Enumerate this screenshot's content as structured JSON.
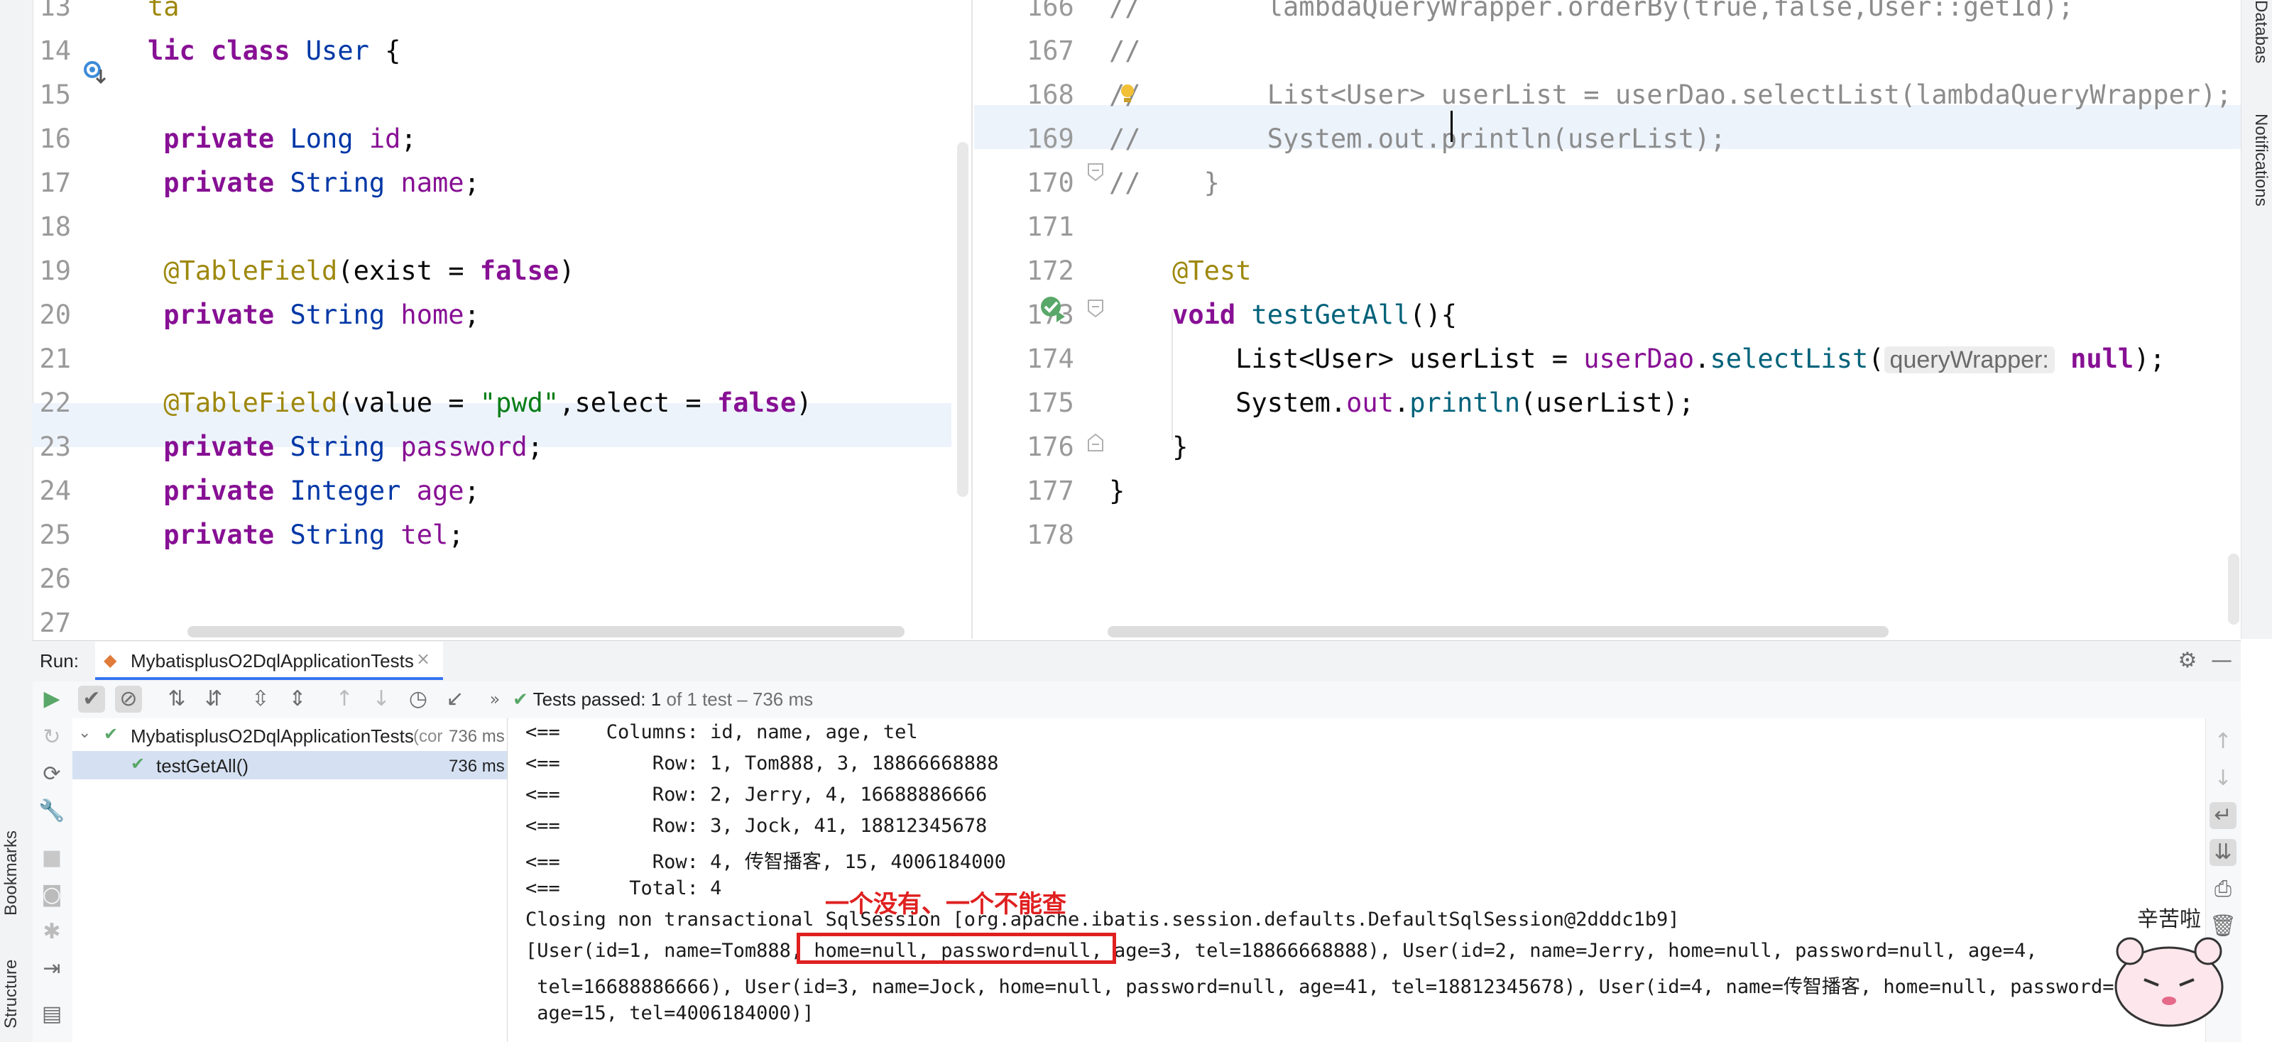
{
  "left_editor": {
    "lines": [
      {
        "num": "13",
        "code": [
          {
            "t": "ta",
            "c": "ann"
          }
        ]
      },
      {
        "num": "14",
        "code": [
          {
            "t": "lic ",
            "c": "kw2"
          },
          {
            "t": "class ",
            "c": "kw2"
          },
          {
            "t": "User",
            "c": "typeb"
          },
          {
            "t": " {",
            "c": ""
          }
        ]
      },
      {
        "num": "15",
        "code": []
      },
      {
        "num": "16",
        "code": [
          {
            "t": " private ",
            "c": "kw2"
          },
          {
            "t": "Long ",
            "c": "typeb"
          },
          {
            "t": "id",
            "c": "fld"
          },
          {
            "t": ";",
            "c": ""
          }
        ]
      },
      {
        "num": "17",
        "code": [
          {
            "t": " private ",
            "c": "kw2"
          },
          {
            "t": "String ",
            "c": "typeb"
          },
          {
            "t": "name",
            "c": "fld"
          },
          {
            "t": ";",
            "c": ""
          }
        ]
      },
      {
        "num": "18",
        "code": []
      },
      {
        "num": "19",
        "code": [
          {
            "t": " @TableField",
            "c": "ann"
          },
          {
            "t": "(exist = ",
            "c": ""
          },
          {
            "t": "false",
            "c": "kw2"
          },
          {
            "t": ")",
            "c": ""
          }
        ]
      },
      {
        "num": "20",
        "code": [
          {
            "t": " private ",
            "c": "kw2"
          },
          {
            "t": "String ",
            "c": "typeb"
          },
          {
            "t": "home",
            "c": "fld"
          },
          {
            "t": ";",
            "c": ""
          }
        ]
      },
      {
        "num": "21",
        "code": []
      },
      {
        "num": "22",
        "code": [
          {
            "t": " @TableField",
            "c": "ann"
          },
          {
            "t": "(value = ",
            "c": ""
          },
          {
            "t": "\"pwd\"",
            "c": "str"
          },
          {
            "t": ",select = ",
            "c": ""
          },
          {
            "t": "false",
            "c": "kw2"
          },
          {
            "t": ")",
            "c": ""
          }
        ]
      },
      {
        "num": "23",
        "code": [
          {
            "t": " private ",
            "c": "kw2"
          },
          {
            "t": "String ",
            "c": "typeb"
          },
          {
            "t": "password",
            "c": "fld"
          },
          {
            "t": ";",
            "c": ""
          }
        ]
      },
      {
        "num": "24",
        "code": [
          {
            "t": " private ",
            "c": "kw2"
          },
          {
            "t": "Integer ",
            "c": "typeb"
          },
          {
            "t": "age",
            "c": "fld"
          },
          {
            "t": ";",
            "c": ""
          }
        ]
      },
      {
        "num": "25",
        "code": [
          {
            "t": " private ",
            "c": "kw2"
          },
          {
            "t": "String ",
            "c": "typeb"
          },
          {
            "t": "tel",
            "c": "fld"
          },
          {
            "t": ";",
            "c": ""
          }
        ]
      },
      {
        "num": "26",
        "code": []
      },
      {
        "num": "27",
        "code": []
      }
    ]
  },
  "right_editor": {
    "lines": [
      {
        "num": "166",
        "code": [
          {
            "t": "//        lambdaQueryWrapper.orderBy(true,false,User::getId);",
            "c": "cmt"
          }
        ]
      },
      {
        "num": "167",
        "code": [
          {
            "t": "//",
            "c": "cmt"
          }
        ]
      },
      {
        "num": "168",
        "code": [
          {
            "t": "//        List<User> userList = userDao.selectList(lambdaQueryWrapper);",
            "c": "cmt"
          }
        ]
      },
      {
        "num": "169",
        "code": [
          {
            "t": "//        System.out.println(userList);",
            "c": "cmt"
          }
        ]
      },
      {
        "num": "170",
        "code": [
          {
            "t": "//    }",
            "c": "cmt"
          }
        ]
      },
      {
        "num": "171",
        "code": []
      },
      {
        "num": "172",
        "code": [
          {
            "t": "    @Test",
            "c": "ann"
          }
        ]
      },
      {
        "num": "173",
        "code": [
          {
            "t": "    void ",
            "c": "kw2"
          },
          {
            "t": "testGetAll",
            "c": "meth"
          },
          {
            "t": "(){",
            "c": ""
          }
        ]
      },
      {
        "num": "174",
        "code": [
          {
            "t": "        List<User> userList = ",
            "c": ""
          },
          {
            "t": "userDao",
            "c": "fld"
          },
          {
            "t": ".",
            "c": ""
          },
          {
            "t": "selectList",
            "c": "meth"
          },
          {
            "t": "(",
            "c": ""
          },
          {
            "t": "queryWrapper:",
            "c": "hint"
          },
          {
            "t": " null",
            "c": "kw2"
          },
          {
            "t": ");",
            "c": ""
          }
        ]
      },
      {
        "num": "175",
        "code": [
          {
            "t": "        System.",
            "c": ""
          },
          {
            "t": "out",
            "c": "fld"
          },
          {
            "t": ".",
            "c": ""
          },
          {
            "t": "println",
            "c": "meth"
          },
          {
            "t": "(userList);",
            "c": ""
          }
        ]
      },
      {
        "num": "176",
        "code": [
          {
            "t": "    }",
            "c": ""
          }
        ]
      },
      {
        "num": "177",
        "code": [
          {
            "t": "}",
            "c": ""
          }
        ]
      },
      {
        "num": "178",
        "code": []
      }
    ]
  },
  "side_labels": {
    "database": "Database",
    "notifications": "Notifications",
    "bookmarks": "Bookmarks",
    "structure": "Structure"
  },
  "run_panel": {
    "run_label": "Run:",
    "tab_label": "MybatisplusO2DqlApplicationTests",
    "tests_passed": "Tests passed:",
    "passed_count": "1",
    "passed_suffix": "of 1 test – 736 ms",
    "tree": [
      {
        "label": "MybatisplusO2DqlApplicationTests",
        "extra": "(cor",
        "time": "736 ms"
      },
      {
        "label": "testGetAll()",
        "extra": "",
        "time": "736 ms"
      }
    ]
  },
  "console": {
    "lines": [
      "<==    Columns: id, name, age, tel",
      "<==        Row: 1, Tom888, 3, 18866668888",
      "<==        Row: 2, Jerry, 4, 16688886666",
      "<==        Row: 3, Jock, 41, 18812345678",
      "<==        Row: 4, 传智播客, 15, 4006184000",
      "<==      Total: 4",
      "Closing non transactional SqlSession [org.apache.ibatis.session.defaults.DefaultSqlSession@2dddc1b9]",
      "[User(id=1, name=Tom888, home=null, password=null, age=3, tel=18866668888), User(id=2, name=Jerry, home=null, password=null, age=4,",
      " tel=16688886666), User(id=3, name=Jock, home=null, password=null, age=41, tel=18812345678), User(id=4, name=传智播客, home=null, password=nu",
      " age=15, tel=4006184000)]"
    ],
    "annotation": "一个没有、一个不能查",
    "sticker_text": "辛苦啦"
  }
}
